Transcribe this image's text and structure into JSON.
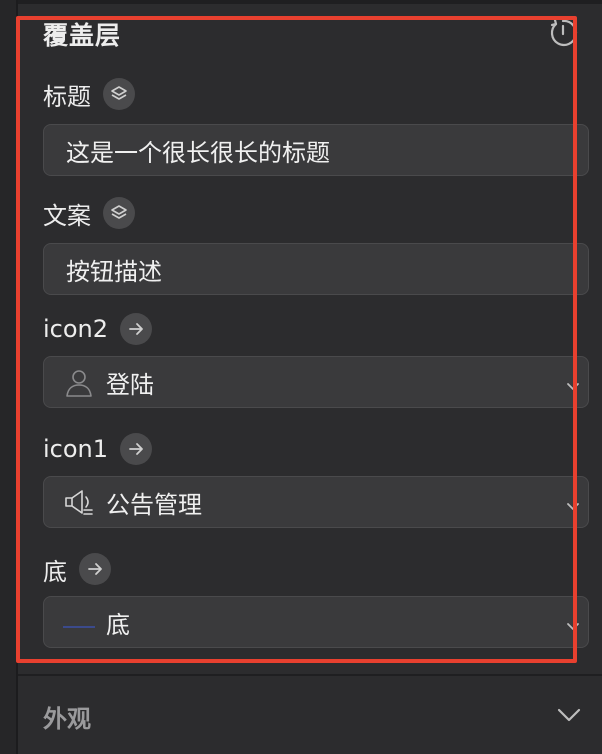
{
  "overlay": {
    "title": "覆盖层",
    "reset_icon": "reset-icon"
  },
  "fields": {
    "title": {
      "label": "标题",
      "badge_icon": "layers-icon",
      "value": "这是一个很长很长的标题"
    },
    "copy": {
      "label": "文案",
      "badge_icon": "layers-icon",
      "value": "按钮描述"
    },
    "icon2": {
      "label": "icon2",
      "badge_icon": "arrow-right-icon",
      "icon": "user-icon",
      "value": "登陆"
    },
    "icon1": {
      "label": "icon1",
      "badge_icon": "arrow-right-icon",
      "icon": "announcement-icon",
      "value": "公告管理"
    },
    "bottom": {
      "label": "底",
      "badge_icon": "arrow-right-icon",
      "icon": "line-icon",
      "value": "底",
      "swatch_color": "#3b4a8c"
    }
  },
  "appearance": {
    "label": "外观"
  },
  "colors": {
    "highlight": "#e8402f",
    "panel_bg": "#2c2c2e",
    "field_bg": "#3a3a3c"
  }
}
